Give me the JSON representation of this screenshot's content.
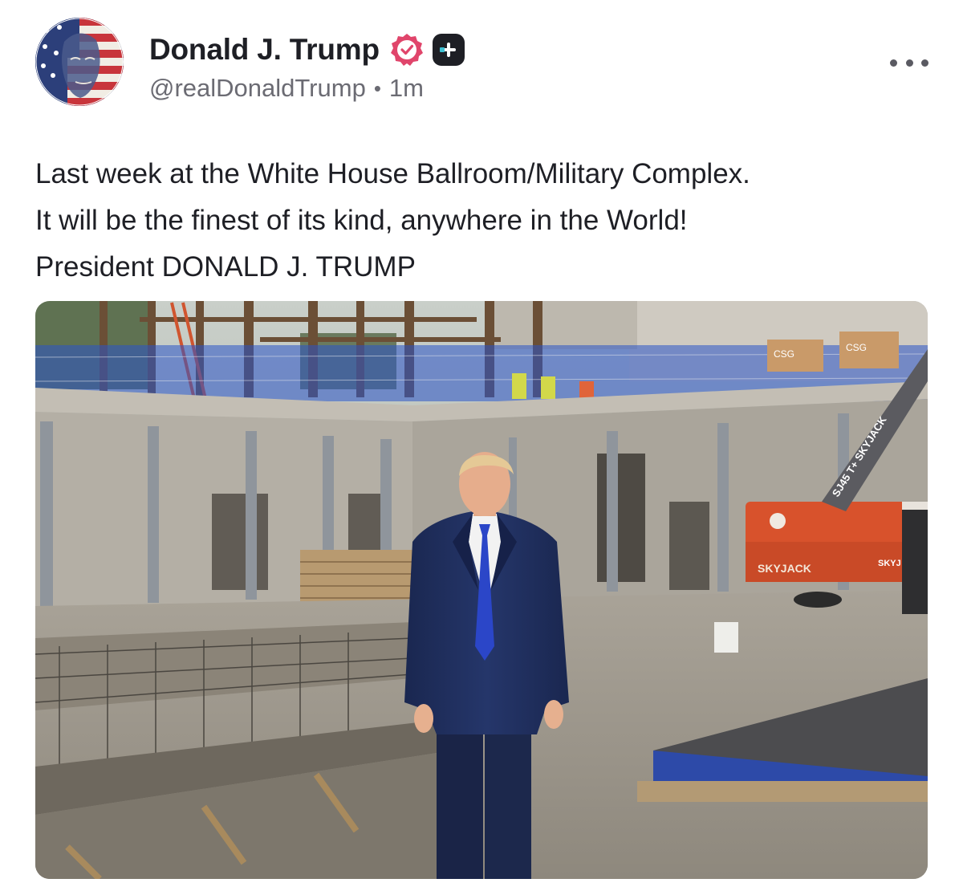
{
  "post": {
    "author": {
      "display_name": "Donald J. Trump",
      "handle": "@realDonaldTrump",
      "separator": "•",
      "time": "1m",
      "verified_icon": "verified-badge-icon",
      "plus_icon": "plus-badge-icon",
      "avatar": "avatar-flag-portrait"
    },
    "text_lines": [
      "Last week at the White House Ballroom/Military Complex.",
      "It will be the finest of its kind, anywhere in the World!",
      "President DONALD J. TRUMP"
    ],
    "menu_icon": "more-options-icon",
    "image": {
      "description_icon": "construction-site-photo",
      "lift_labels": [
        "SJ45 T+ SKYJACK",
        "SKYJACK",
        "SKYJ"
      ],
      "crate_labels": [
        "CSG",
        "CSG"
      ]
    },
    "colors": {
      "verified": "#e0456b",
      "plus_badge": "#1e1f25",
      "handle_text": "#6b6b73",
      "lift_orange": "#d8522c",
      "suit_navy": "#1f2e58",
      "tie_blue": "#2b46c8"
    }
  }
}
